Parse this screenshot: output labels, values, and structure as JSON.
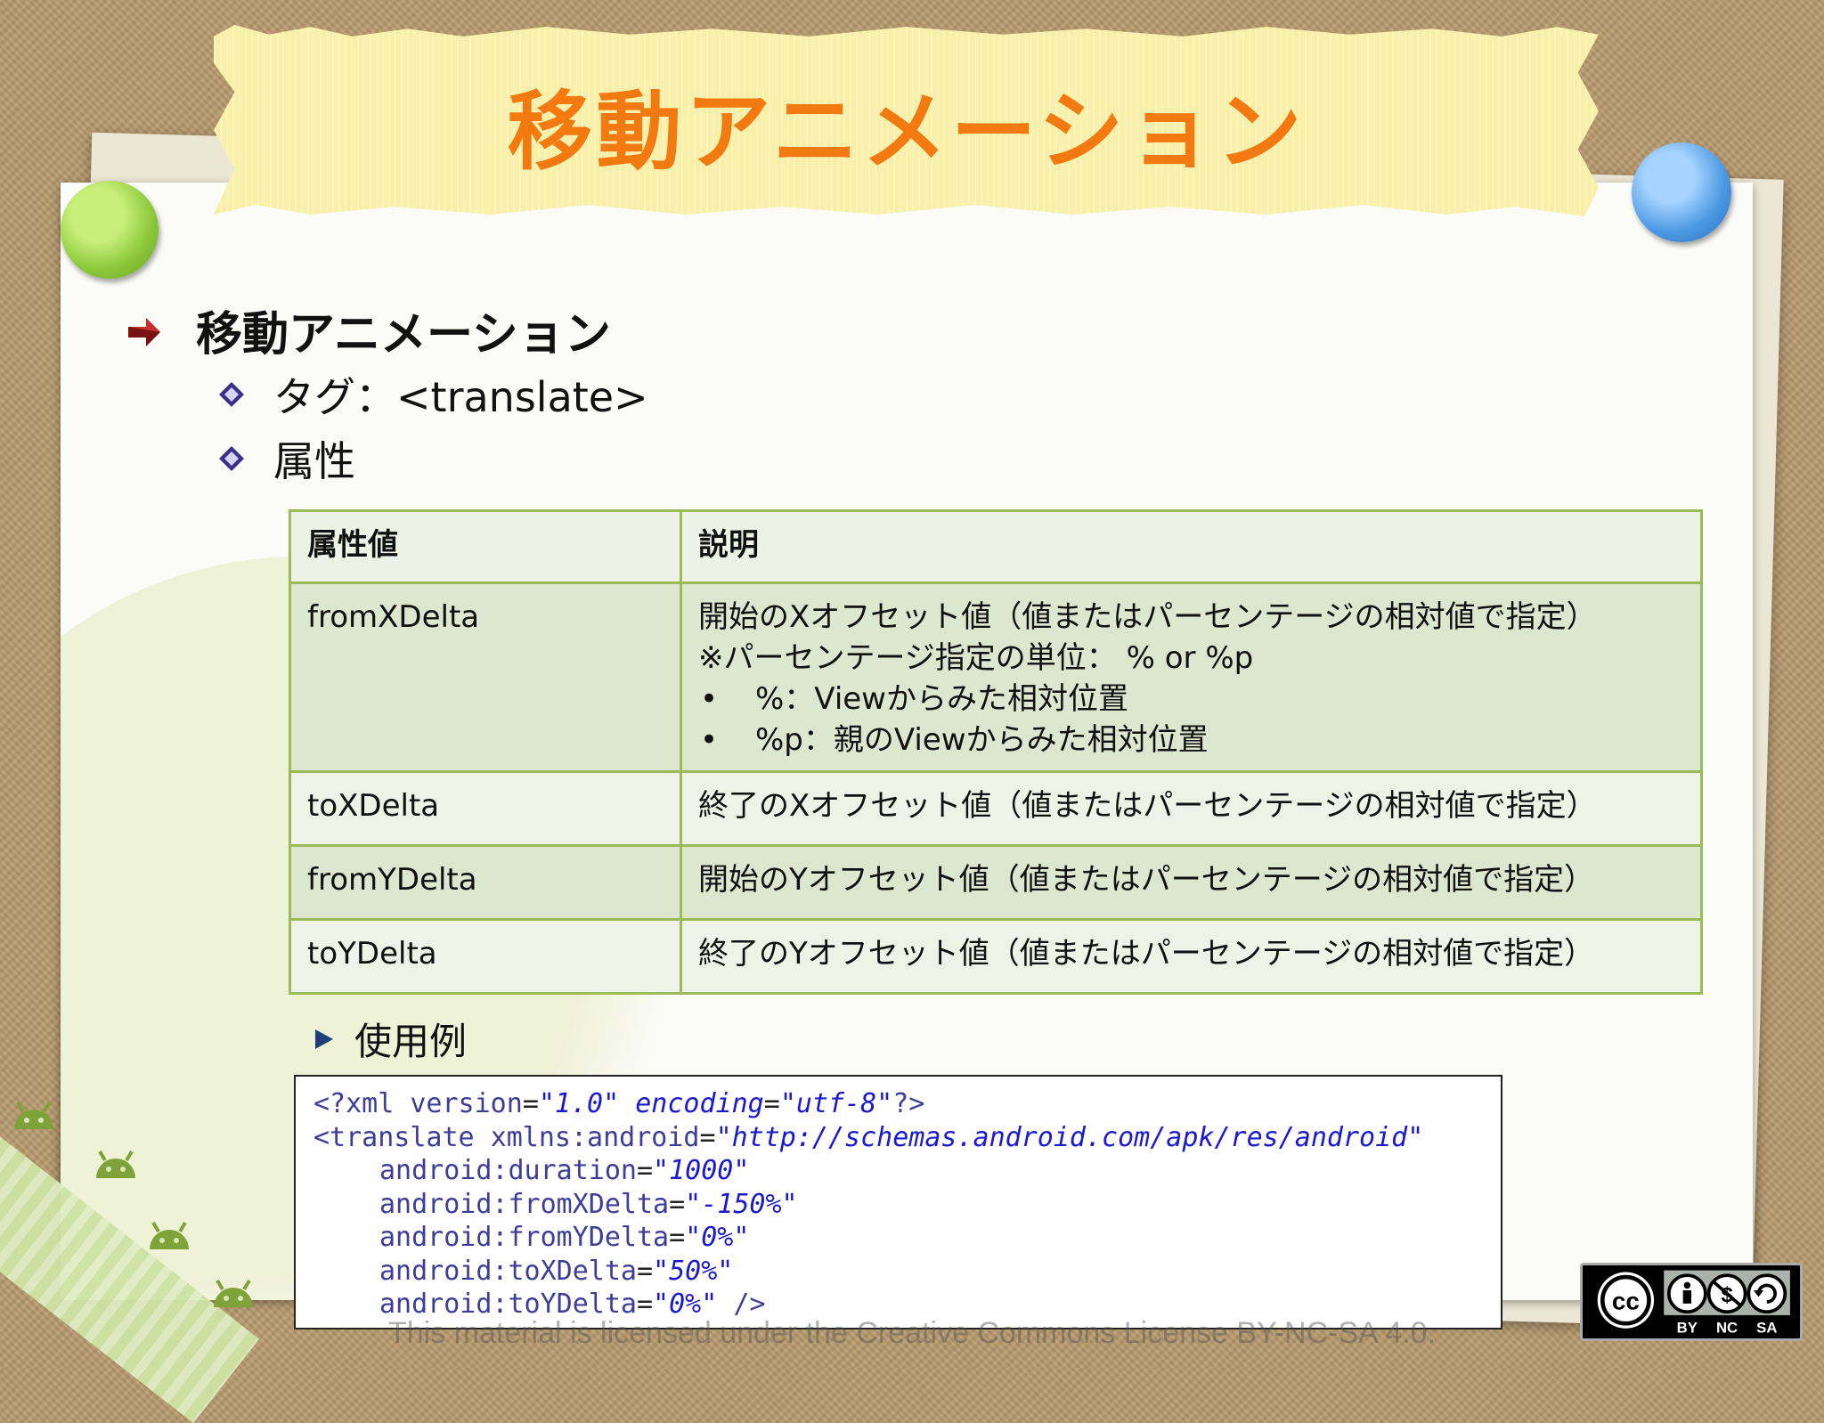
{
  "slide": {
    "title": "移動アニメーション",
    "bullet_main": "移動アニメーション",
    "bullet_tag": "タグ：<translate>",
    "bullet_attr": "属性",
    "bullet_example": "使用例"
  },
  "table": {
    "headers": [
      "属性値",
      "説明"
    ],
    "rows": [
      {
        "name": "fromXDelta",
        "desc": "開始のXオフセット値（値またはパーセンテージの相対値で指定）",
        "note": "※パーセンテージ指定の単位： % or %p",
        "bullets": [
          "%：Viewからみた相対位置",
          "%p：親のViewからみた相対位置"
        ]
      },
      {
        "name": "toXDelta",
        "desc": "終了のXオフセット値（値またはパーセンテージの相対値で指定）"
      },
      {
        "name": "fromYDelta",
        "desc": "開始のYオフセット値（値またはパーセンテージの相対値で指定）"
      },
      {
        "name": "toYDelta",
        "desc": "終了のYオフセット値（値またはパーセンテージの相対値で指定）"
      }
    ],
    "bullet_symbol": "•"
  },
  "code": {
    "line1": {
      "open": "<?xml ",
      "a1": "version",
      "v1": "\"1.0\"",
      "a2": " encoding",
      "v2": "\"utf-8\"",
      "close": "?>"
    },
    "line2": {
      "open": "<translate ",
      "a1": "xmlns:android",
      "v1": "\"http://schemas.android.com/apk/res/android\""
    },
    "line3": {
      "a": "android:duration",
      "v": "\"1000\""
    },
    "line4": {
      "a": "android:fromXDelta",
      "v": "\"-150%\""
    },
    "line5": {
      "a": "android:fromYDelta",
      "v": "\"0%\""
    },
    "line6": {
      "a": "android:toXDelta",
      "v": "\"50%\""
    },
    "line7": {
      "a": "android:toYDelta",
      "v": "\"0%\"",
      "close": " />"
    },
    "eq": "="
  },
  "footer": {
    "license_text": "This material is licensed under the Creative Commons License BY-NC-SA 4.0.",
    "badge_cc": "cc",
    "badge_labels": [
      "BY",
      "NC",
      "SA"
    ]
  },
  "colors": {
    "title": "#f27a10",
    "table_border": "#9bbb59",
    "code_tag": "#3d3d9a",
    "code_value": "#1a1ad0"
  }
}
